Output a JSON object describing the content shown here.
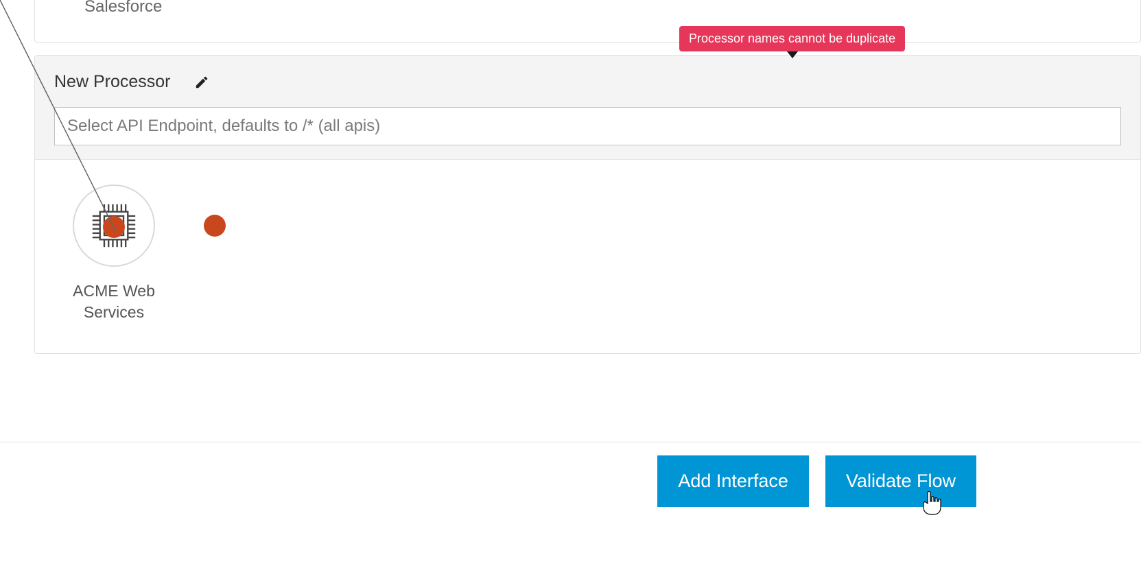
{
  "top_card": {
    "label": "Salesforce"
  },
  "tooltip": {
    "message": "Processor names cannot be duplicate"
  },
  "processor": {
    "title": "New Processor",
    "endpoint_placeholder": "Select API Endpoint, defaults to /* (all apis)",
    "endpoint_value": "",
    "services": [
      {
        "name": "ACME Web Services"
      }
    ]
  },
  "footer": {
    "add_interface_label": "Add Interface",
    "validate_flow_label": "Validate Flow"
  }
}
